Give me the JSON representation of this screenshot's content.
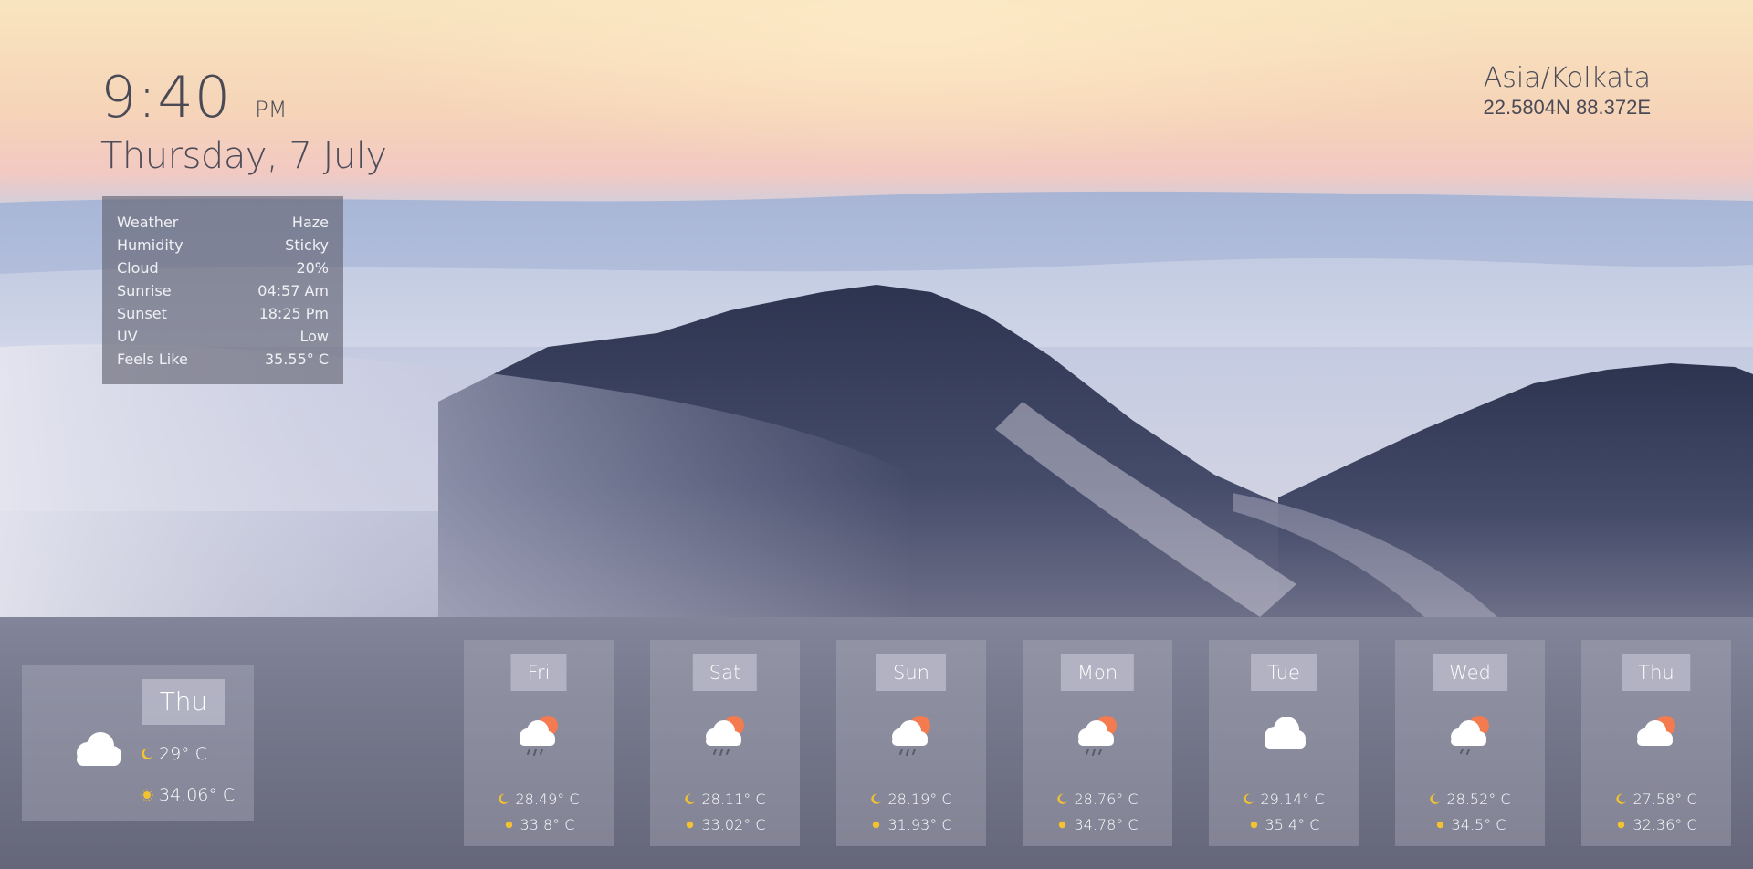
{
  "clock": {
    "time": "9:40",
    "ampm": "PM",
    "date": "Thursday, 7 July"
  },
  "location": {
    "timezone": "Asia/Kolkata",
    "coords": "22.5804N 88.372E"
  },
  "details": [
    {
      "label": "Weather",
      "value": "Haze"
    },
    {
      "label": "Humidity",
      "value": "Sticky"
    },
    {
      "label": "Cloud",
      "value": "20%"
    },
    {
      "label": "Sunrise",
      "value": "04:57 Am"
    },
    {
      "label": "Sunset",
      "value": "18:25 Pm"
    },
    {
      "label": "UV",
      "value": "Low"
    },
    {
      "label": "Feels Like",
      "value": "35.55° C"
    }
  ],
  "today": {
    "day": "Thu",
    "icon": "cloud-icon",
    "night": "29° C",
    "day_temp": "34.06° C"
  },
  "forecast": [
    {
      "day": "Fri",
      "icon": "cloud-sun-rain-icon",
      "night": "28.49° C",
      "day_temp": "33.8° C"
    },
    {
      "day": "Sat",
      "icon": "cloud-sun-rain-icon",
      "night": "28.11° C",
      "day_temp": "33.02° C"
    },
    {
      "day": "Sun",
      "icon": "cloud-sun-rain-icon",
      "night": "28.19° C",
      "day_temp": "31.93° C"
    },
    {
      "day": "Mon",
      "icon": "cloud-sun-rain-icon",
      "night": "28.76° C",
      "day_temp": "34.78° C"
    },
    {
      "day": "Tue",
      "icon": "cloud-icon",
      "night": "29.14° C",
      "day_temp": "35.4° C"
    },
    {
      "day": "Wed",
      "icon": "cloud-sun-rain-icon",
      "night": "28.52° C",
      "day_temp": "34.5° C"
    },
    {
      "day": "Thu",
      "icon": "cloud-sun-icon",
      "night": "27.58° C",
      "day_temp": "32.36° C"
    }
  ],
  "colors": {
    "sun": "#f47a4f",
    "cloud": "#ffffff",
    "moon": "#f2c230",
    "rain": "#5a5a68"
  }
}
